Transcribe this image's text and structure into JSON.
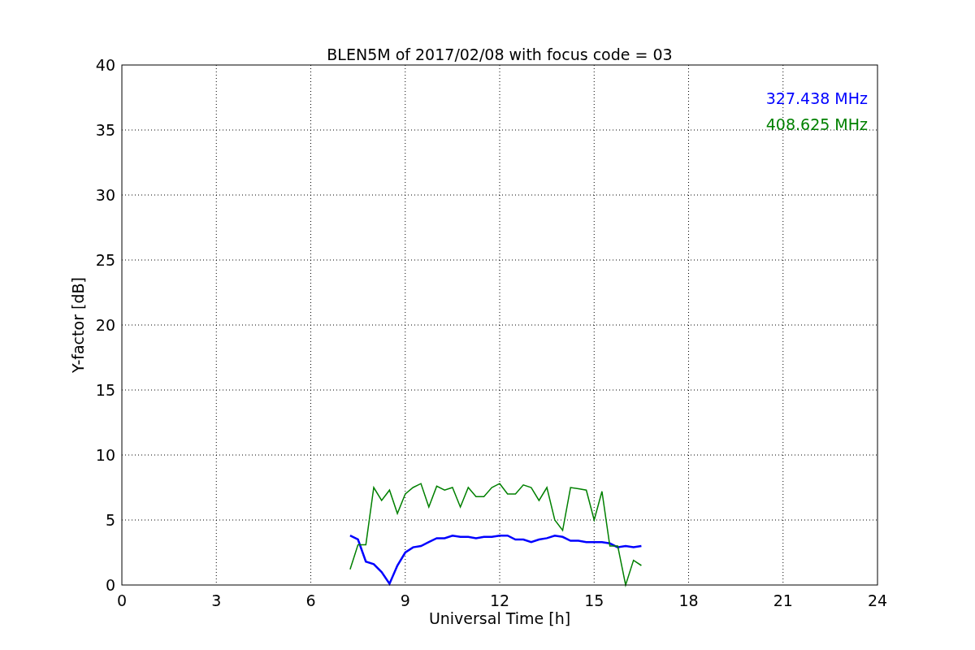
{
  "chart_data": {
    "type": "line",
    "title": "BLEN5M of 2017/02/08 with focus code = 03",
    "xlabel": "Universal Time [h]",
    "ylabel": "Y-factor [dB]",
    "x": [
      7.25,
      7.5,
      7.75,
      8.0,
      8.25,
      8.5,
      8.75,
      9.0,
      9.25,
      9.5,
      9.75,
      10.0,
      10.25,
      10.5,
      10.75,
      11.0,
      11.25,
      11.5,
      11.75,
      12.0,
      12.25,
      12.5,
      12.75,
      13.0,
      13.25,
      13.5,
      13.75,
      14.0,
      14.25,
      14.5,
      14.75,
      15.0,
      15.25,
      15.5,
      15.75,
      16.0,
      16.25,
      16.5
    ],
    "series": [
      {
        "name": "327.438 MHz",
        "color": "#0000ff",
        "values": [
          3.8,
          3.5,
          1.8,
          1.6,
          1.0,
          0.1,
          1.5,
          2.5,
          2.9,
          3.0,
          3.3,
          3.6,
          3.6,
          3.8,
          3.7,
          3.7,
          3.6,
          3.7,
          3.7,
          3.8,
          3.8,
          3.5,
          3.5,
          3.3,
          3.5,
          3.6,
          3.8,
          3.7,
          3.4,
          3.4,
          3.3,
          3.3,
          3.3,
          3.2,
          2.9,
          3.0,
          2.9,
          3.0
        ]
      },
      {
        "name": "408.625 MHz",
        "color": "#008000",
        "values": [
          1.2,
          3.1,
          3.1,
          7.5,
          6.5,
          7.3,
          5.5,
          7.0,
          7.5,
          7.8,
          6.0,
          7.6,
          7.3,
          7.5,
          6.0,
          7.5,
          6.8,
          6.8,
          7.5,
          7.8,
          7.0,
          7.0,
          7.7,
          7.5,
          6.5,
          7.5,
          5.0,
          4.2,
          7.5,
          7.4,
          7.3,
          5.0,
          7.2,
          3.0,
          3.0,
          0,
          1.9,
          1.5
        ]
      }
    ],
    "grid": true,
    "xlim": [
      0,
      24
    ],
    "ylim": [
      0,
      40
    ],
    "xticks": [
      0,
      3,
      6,
      9,
      12,
      15,
      18,
      21,
      24
    ],
    "yticks": [
      0,
      5,
      10,
      15,
      20,
      25,
      30,
      35,
      40
    ]
  }
}
